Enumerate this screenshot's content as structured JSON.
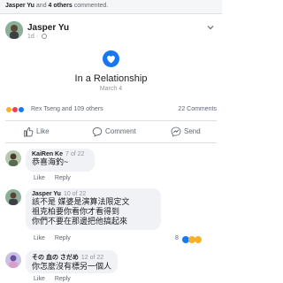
{
  "notification": {
    "actor": "Jasper Yu",
    "connector": "and",
    "others": "4 others",
    "verb": "commented."
  },
  "post": {
    "author": "Jasper Yu",
    "age": "1d",
    "event_title": "In a Relationship",
    "event_date": "March 4",
    "reactions_text": "Rex Tseng and 109 others",
    "comments_count": "22 Comments"
  },
  "actions": {
    "like": "Like",
    "comment": "Comment",
    "send": "Send"
  },
  "comments": [
    {
      "name": "KaiRen Ke",
      "time": "7 of 22",
      "lines": [
        "恭喜海釣~"
      ],
      "like": "Like",
      "reply": "Reply"
    },
    {
      "name": "Jasper Yu",
      "time": "10 of 22",
      "lines": [
        "該不是 媒婆是演算法限定文",
        "祖克柏要你看你才看得到",
        "你們不要在那邊把他搞起來"
      ],
      "like": "Like",
      "reply": "Reply",
      "reaction_count": "8"
    },
    {
      "name": "その 血の さだめ",
      "time": "12 of 22",
      "lines": [
        "你怎麼沒有標另一個人"
      ],
      "like": "Like",
      "reply": "Reply"
    }
  ],
  "colors": {
    "accent": "#1877f2",
    "love": "#f33e58",
    "haha": "#f7b125",
    "like": "#1877f2"
  }
}
